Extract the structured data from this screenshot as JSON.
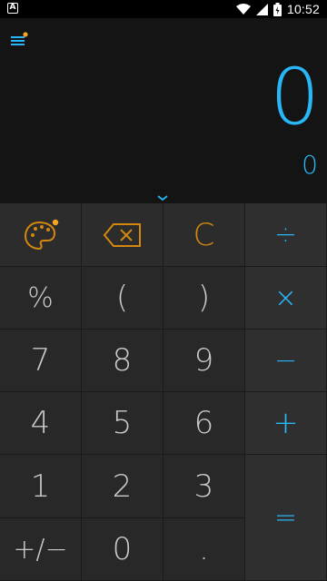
{
  "status_bar": {
    "time": "10:52",
    "notification_icon": "a-icon",
    "icons": [
      "wifi-icon",
      "signal-icon",
      "battery-icon"
    ]
  },
  "display": {
    "result": "0",
    "secondary": "0"
  },
  "colors": {
    "accent": "#29b6f6",
    "function": "#d4880f",
    "key_text": "#c9c9c9",
    "key_bg": "#282828",
    "op_bg": "#2f2f2f"
  },
  "keys": {
    "theme": "palette-icon",
    "backspace": "backspace-icon",
    "clear": "C",
    "divide": "÷",
    "percent": "%",
    "lparen": "(",
    "rparen": ")",
    "multiply": "×",
    "seven": "7",
    "eight": "8",
    "nine": "9",
    "minus": "−",
    "four": "4",
    "five": "5",
    "six": "6",
    "plus": "+",
    "one": "1",
    "two": "2",
    "three": "3",
    "equals": "=",
    "negate": "+/−",
    "zero": "0",
    "decimal": "."
  }
}
